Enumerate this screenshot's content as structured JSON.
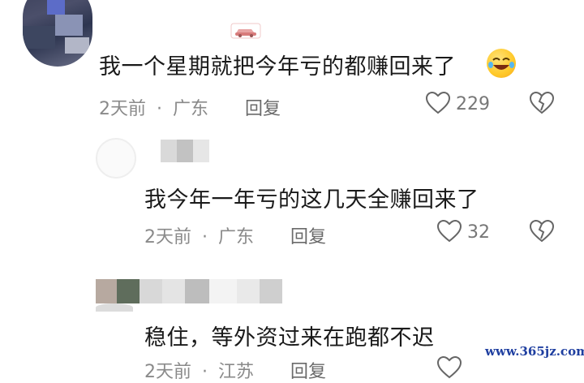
{
  "comments": [
    {
      "text": "我一个星期就把今年亏的都赚回来了",
      "meta_time": "2天前",
      "meta_dot": "·",
      "meta_location": "广东",
      "reply_label": "回复",
      "likes": "229"
    },
    {
      "text": "我今年一年亏的这几天全赚回来了",
      "meta_time": "2天前",
      "meta_dot": "·",
      "meta_location": "广东",
      "reply_label": "回复",
      "likes": "32"
    },
    {
      "text": "稳住，等外资过来在跑都不迟",
      "meta_time": "2天前",
      "meta_dot": "·",
      "meta_location": "江苏",
      "reply_label": "回复",
      "likes": ""
    }
  ],
  "icons": {
    "like": "heart-outline-icon",
    "dislike": "broken-heart-icon",
    "emoji": "rolling-laughing-emoji-icon",
    "badge": "car-badge-icon"
  },
  "watermark": "www.365jz.com"
}
